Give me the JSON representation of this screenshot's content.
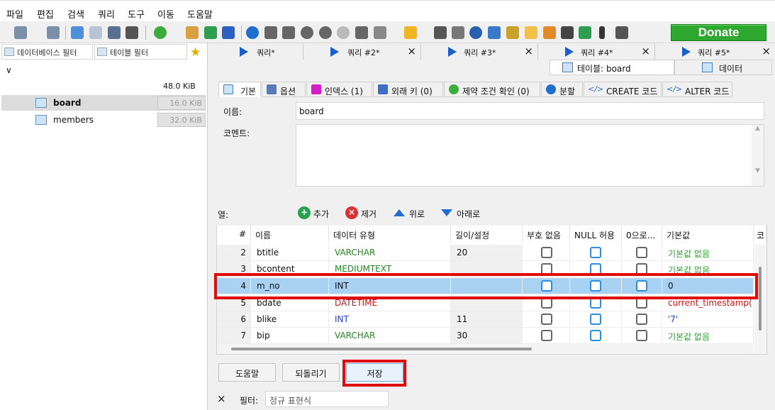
{
  "menu": [
    "파일",
    "편집",
    "검색",
    "쿼리",
    "도구",
    "이동",
    "도움말"
  ],
  "donate_label": "Donate",
  "left": {
    "db_filter": "데이터베이스 필터",
    "table_filter": "테이블 필터",
    "db_size": "48.0 KiB",
    "tables": [
      {
        "name": "board",
        "size": "16.0 KiB",
        "selected": true
      },
      {
        "name": "members",
        "size": "32.0 KiB",
        "selected": false
      }
    ]
  },
  "query_tabs": [
    "쿼리*",
    "쿼리 #2*",
    "쿼리 #3*",
    "쿼리 #4*",
    "쿼리 #5*"
  ],
  "result_tabs": {
    "table": "테이블: board",
    "data": "데이터"
  },
  "sub_tabs": [
    "기본",
    "옵션",
    "인덱스 (1)",
    "외래 키 (0)",
    "제약 조건 확인 (0)",
    "분할",
    "CREATE 코드",
    "ALTER 코드"
  ],
  "form": {
    "name_label": "이름:",
    "name_value": "board",
    "comment_label": "코멘트:"
  },
  "columns_bar": {
    "label": "열:",
    "add": "추가",
    "remove": "제거",
    "up": "위로",
    "down": "아래로"
  },
  "grid": {
    "headers": [
      "#",
      "이름",
      "데이터 유형",
      "길이/설정",
      "부호 없음",
      "NULL 허용",
      "0으로...",
      "기본값",
      "코"
    ],
    "rows": [
      {
        "num": "2",
        "name": "btitle",
        "type": "VARCHAR",
        "type_color": "#1e8a1e",
        "len": "20",
        "unsigned": false,
        "null": false,
        "zero": false,
        "default": "기본값 없음",
        "default_color": "#2e9e2e"
      },
      {
        "num": "3",
        "name": "bcontent",
        "type": "MEDIUMTEXT",
        "type_color": "#1e8a1e",
        "len": "",
        "unsigned": false,
        "null": false,
        "zero": false,
        "default": "기본값 없음",
        "default_color": "#2e9e2e"
      },
      {
        "num": "4",
        "name": "m_no",
        "type": "INT",
        "type_color": "#111111",
        "len": "",
        "unsigned": false,
        "null": false,
        "zero": false,
        "default": "0",
        "default_color": "#111111"
      },
      {
        "num": "5",
        "name": "bdate",
        "type": "DATETIME",
        "type_color": "#c81414",
        "len": "",
        "unsigned": false,
        "null": false,
        "zero": false,
        "default": "current_timestamp()",
        "default_color": "#c81414"
      },
      {
        "num": "6",
        "name": "blike",
        "type": "INT",
        "type_color": "#1c3fd6",
        "len": "11",
        "unsigned": false,
        "null": false,
        "zero": false,
        "default": "'7'",
        "default_color": "#1c3fd6"
      },
      {
        "num": "7",
        "name": "bip",
        "type": "VARCHAR",
        "type_color": "#1e8a1e",
        "len": "30",
        "unsigned": false,
        "null": false,
        "zero": false,
        "default": "기본값 없음",
        "default_color": "#2e9e2e"
      }
    ]
  },
  "buttons": {
    "help": "도움말",
    "revert": "되돌리기",
    "save": "저장"
  },
  "filterbar": {
    "label": "필터:",
    "placeholder": "정규 표현식"
  }
}
